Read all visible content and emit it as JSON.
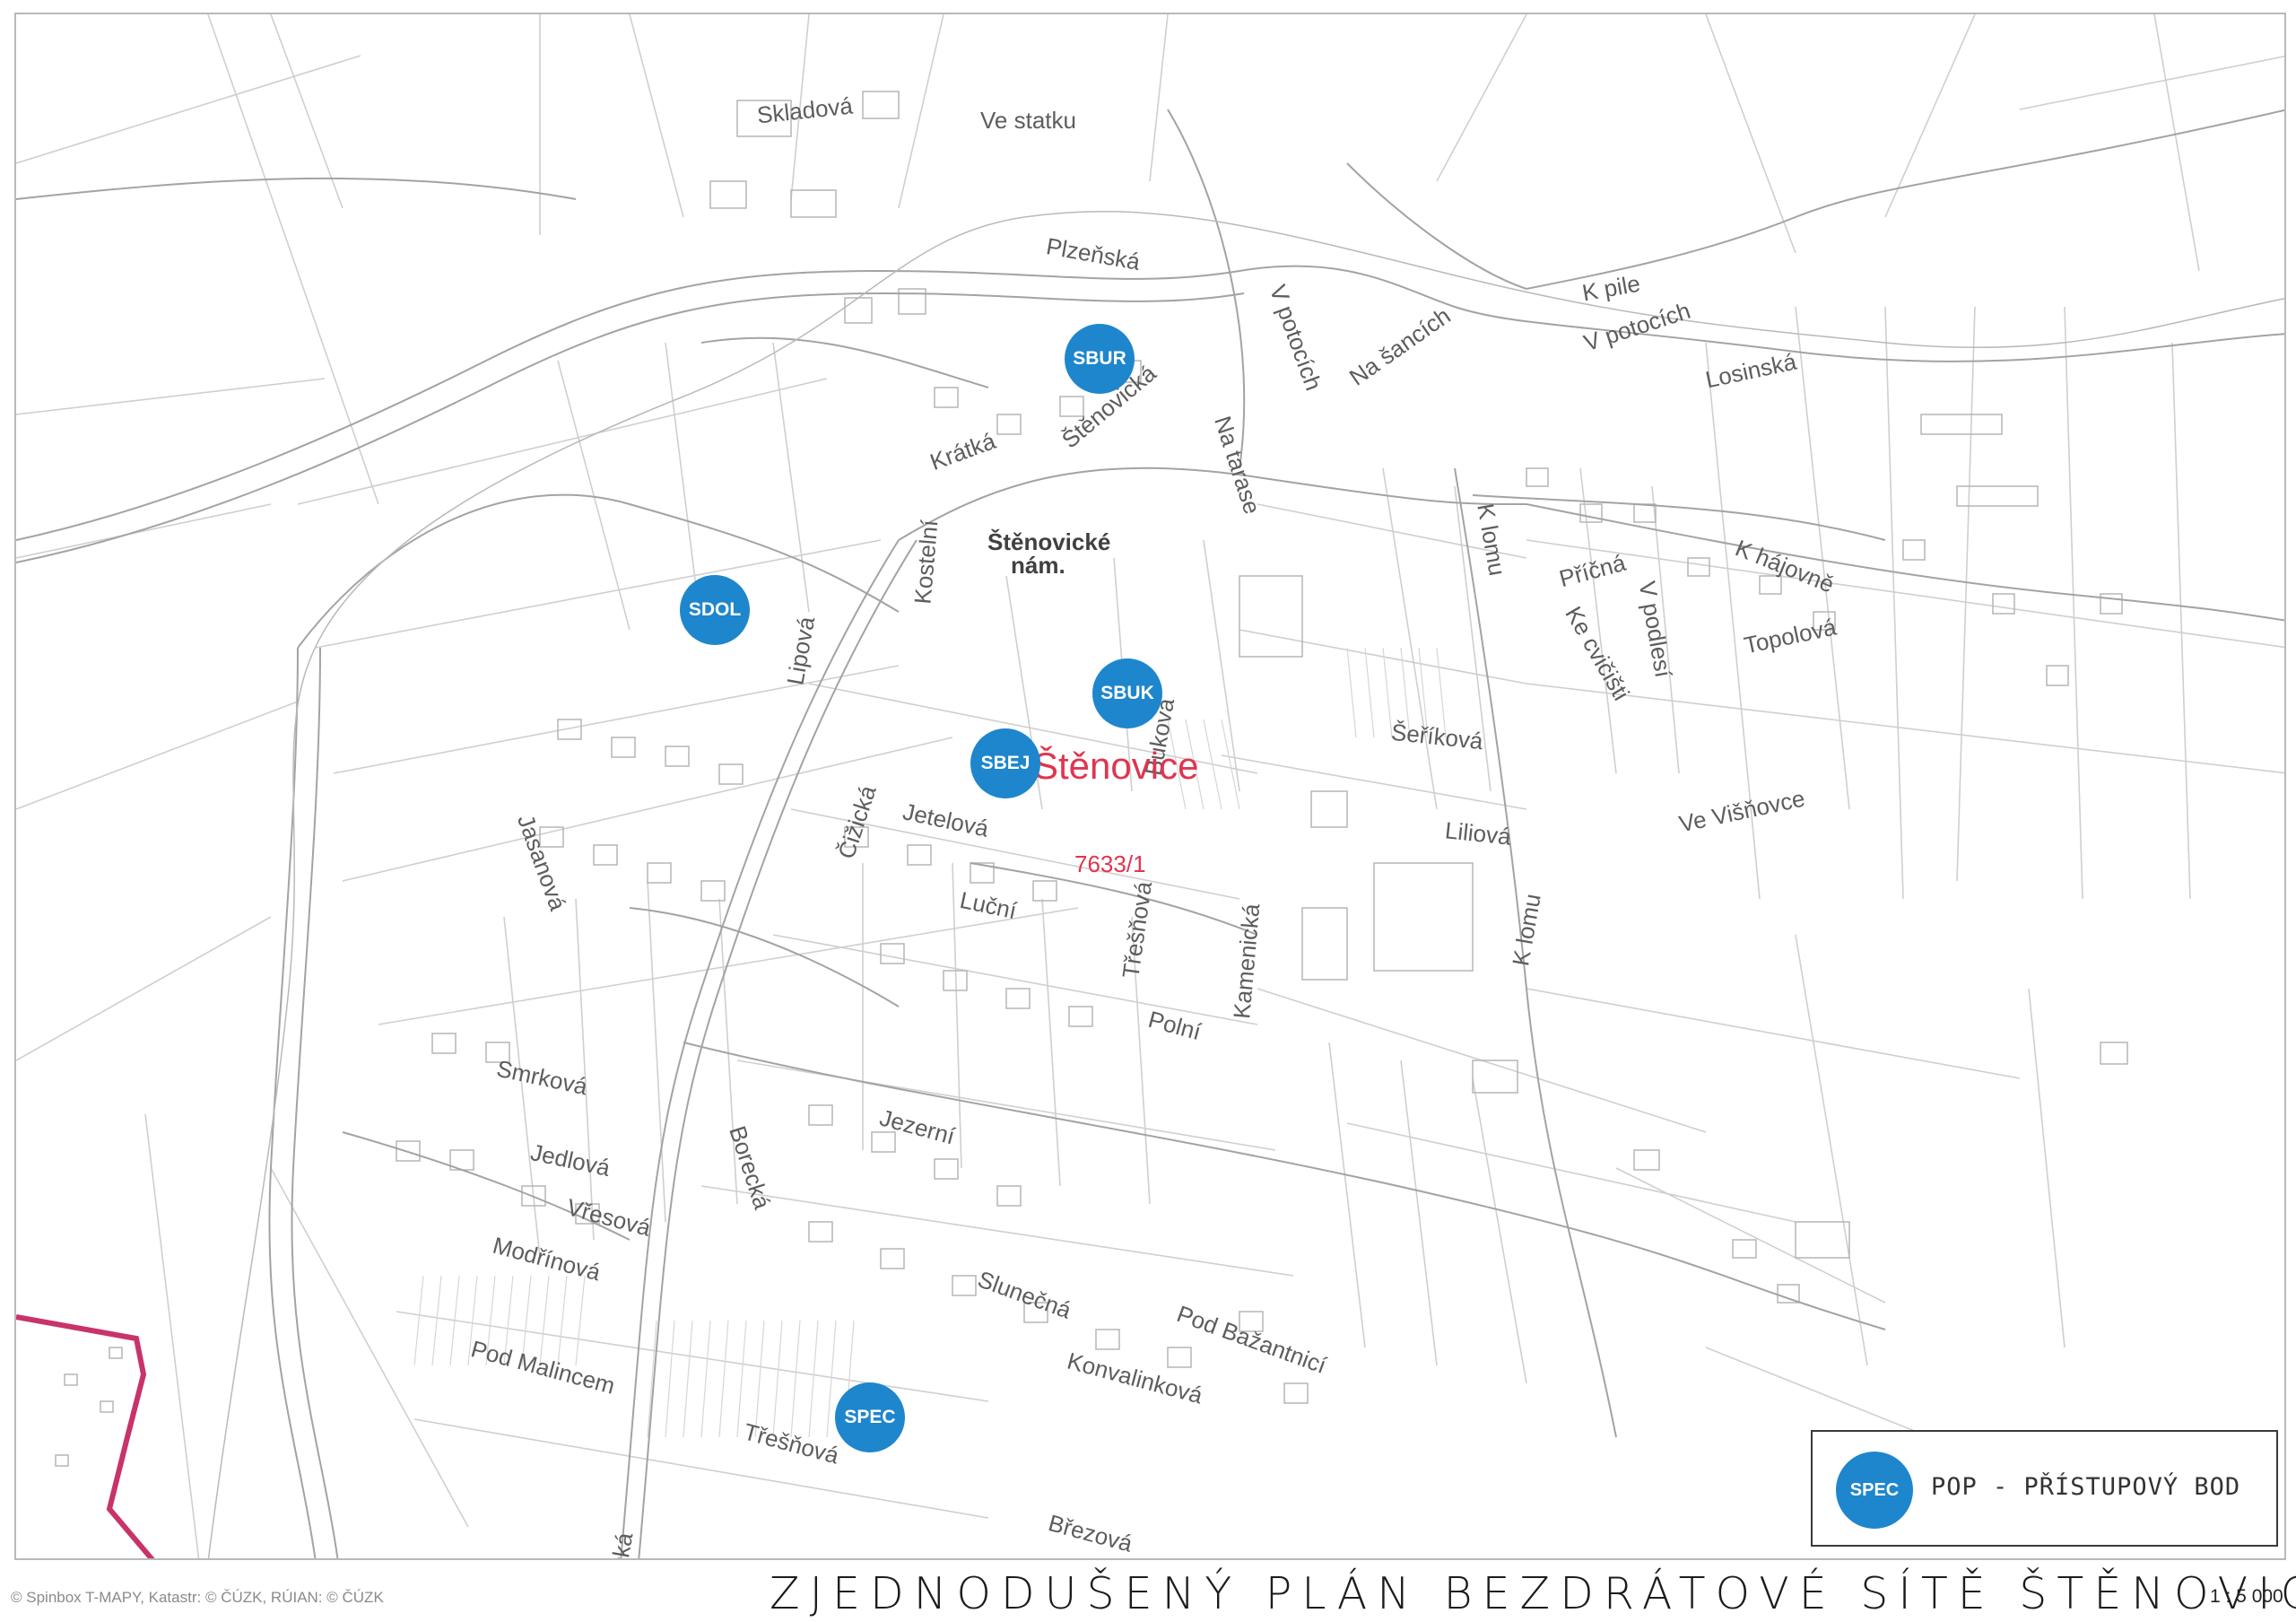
{
  "map": {
    "title": "ZJEDNODUŠENÝ PLÁN BEZDRÁTOVÉ SÍTĚ ŠTĚNOVICE",
    "scale": "1 : 5 000",
    "credits": "© Spinbox T-MAPY, Katastr: © ČÚZK, RÚIAN: © ČÚZK",
    "town_label": "Štěnovice",
    "parcel_label": "7633/1",
    "colors": {
      "background": "#ffffff",
      "map_lines": "#c8c8c8",
      "road_casing": "#9e9e9e",
      "street_text": "#5d5d5d",
      "poi_fill": "#1e86cc",
      "boundary": "#c8336a",
      "town_label": "#e0354f",
      "frame": "#b9b9b9"
    }
  },
  "streets": [
    {
      "id": "skladova",
      "name": "Skladová"
    },
    {
      "id": "ve-statku",
      "name": "Ve statku"
    },
    {
      "id": "plzenska",
      "name": "Plzeňská"
    },
    {
      "id": "v-potocich-1",
      "name": "V potocích"
    },
    {
      "id": "na-sancich",
      "name": "Na šancích"
    },
    {
      "id": "k-pile",
      "name": "K pile"
    },
    {
      "id": "v-potocich-2",
      "name": "V potocích"
    },
    {
      "id": "losinska",
      "name": "Losinská"
    },
    {
      "id": "stenovicka",
      "name": "Štěnovická"
    },
    {
      "id": "kratka",
      "name": "Krátká"
    },
    {
      "id": "na-tarase",
      "name": "Na tarase"
    },
    {
      "id": "kostelni",
      "name": "Kostelní"
    },
    {
      "id": "stenovicke-nam-1",
      "name": "Štěnovické",
      "bold": true
    },
    {
      "id": "stenovicke-nam-2",
      "name": "nám.",
      "bold": true
    },
    {
      "id": "k-lomu-1",
      "name": "K lomu"
    },
    {
      "id": "pricna",
      "name": "Příčná"
    },
    {
      "id": "k-hajovne",
      "name": "K hájovně"
    },
    {
      "id": "v-podlesi",
      "name": "V podlesí"
    },
    {
      "id": "ke-cvicisti",
      "name": "Ke cvičišti"
    },
    {
      "id": "topolova",
      "name": "Topolová"
    },
    {
      "id": "lipova",
      "name": "Lipová"
    },
    {
      "id": "bukova",
      "name": "Buková"
    },
    {
      "id": "serikova",
      "name": "Šeříková"
    },
    {
      "id": "liliova",
      "name": "Liliová"
    },
    {
      "id": "ve-visnovce",
      "name": "Ve Višňovce"
    },
    {
      "id": "jasanova",
      "name": "Jasanová"
    },
    {
      "id": "cizicka",
      "name": "Čižická"
    },
    {
      "id": "jetelova",
      "name": "Jetelová"
    },
    {
      "id": "lucni",
      "name": "Luční"
    },
    {
      "id": "tresnova-1",
      "name": "Třešňová"
    },
    {
      "id": "kamenicka",
      "name": "Kamenická"
    },
    {
      "id": "k-lomu-2",
      "name": "K lomu"
    },
    {
      "id": "polni",
      "name": "Polní"
    },
    {
      "id": "smrkova",
      "name": "Smrková"
    },
    {
      "id": "jezerni",
      "name": "Jezerní"
    },
    {
      "id": "jedlova",
      "name": "Jedlová"
    },
    {
      "id": "vresova",
      "name": "Vřesová"
    },
    {
      "id": "borecka",
      "name": "Borecká"
    },
    {
      "id": "modrinova",
      "name": "Modřínová"
    },
    {
      "id": "slunecna",
      "name": "Slunečná"
    },
    {
      "id": "pod-bazantnici",
      "name": "Pod Bažantnicí"
    },
    {
      "id": "pod-malincem",
      "name": "Pod Malincem"
    },
    {
      "id": "konvalinkova",
      "name": "Konvalinková"
    },
    {
      "id": "tresnova-2",
      "name": "Třešňová"
    },
    {
      "id": "brezova",
      "name": "Březová"
    },
    {
      "id": "cizicka-2",
      "name": "ická"
    }
  ],
  "access_points": [
    {
      "id": "sbur",
      "label": "SBUR"
    },
    {
      "id": "sdol",
      "label": "SDOL"
    },
    {
      "id": "sbuk",
      "label": "SBUK"
    },
    {
      "id": "sbej",
      "label": "SBEJ"
    },
    {
      "id": "spec",
      "label": "SPEC"
    }
  ],
  "legend": {
    "symbol": "SPEC",
    "text": "POP - PŘÍSTUPOVÝ BOD"
  }
}
